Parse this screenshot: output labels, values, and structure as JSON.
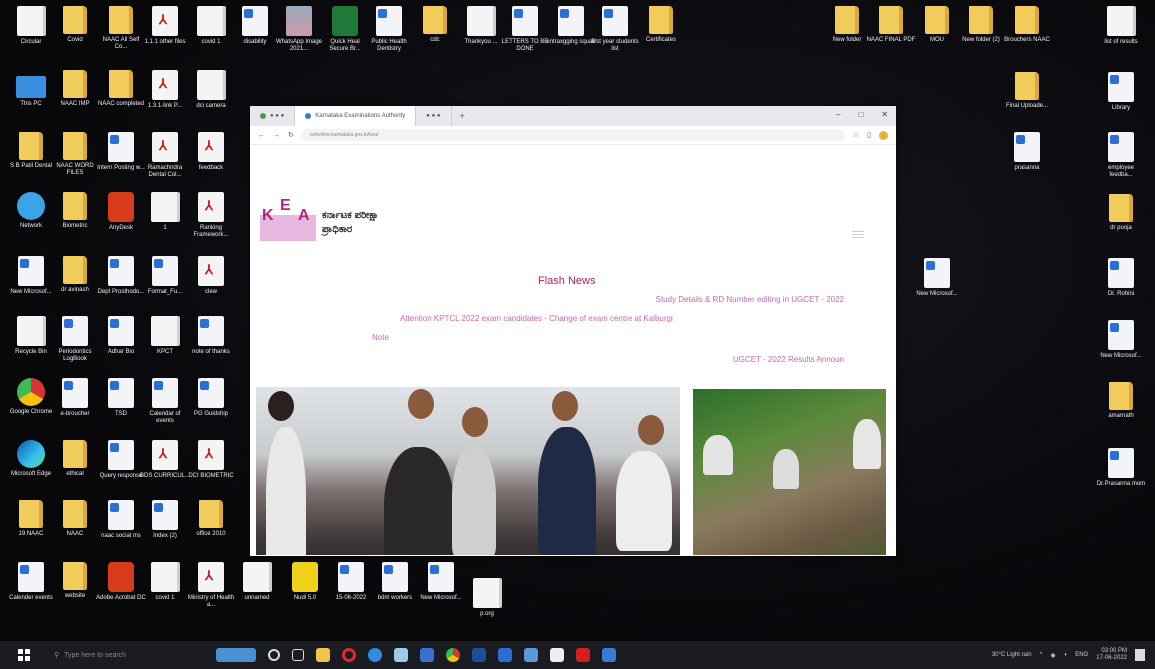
{
  "desktop_icons": [
    {
      "label": "Circular",
      "type": "file"
    },
    {
      "label": "Covid",
      "type": "folder"
    },
    {
      "label": "NAAC All Self Co...",
      "type": "folder"
    },
    {
      "label": "1.1.1 other files",
      "type": "pdf"
    },
    {
      "label": "covid 1",
      "type": "file"
    },
    {
      "label": "disability",
      "type": "word"
    },
    {
      "label": "WhatsApp Image 2021...",
      "type": "img"
    },
    {
      "label": "Quick Heal Secure Br...",
      "type": "green"
    },
    {
      "label": "Public Health Dentistry",
      "type": "word"
    },
    {
      "label": "cdc",
      "type": "folder"
    },
    {
      "label": "Thankyou ...",
      "type": "file"
    },
    {
      "label": "LETTERS TO BE DONE",
      "type": "word"
    },
    {
      "label": "entraxgging squad",
      "type": "word"
    },
    {
      "label": "first year students list",
      "type": "word"
    },
    {
      "label": "Certificates",
      "type": "folder"
    },
    {
      "label": "New folder",
      "type": "folder"
    },
    {
      "label": "NAAC FINAL PDF",
      "type": "folder"
    },
    {
      "label": "MOU",
      "type": "folder"
    },
    {
      "label": "New folder (2)",
      "type": "folder"
    },
    {
      "label": "Brouchers NAAC",
      "type": "folder"
    },
    {
      "label": "list of results",
      "type": "file"
    },
    {
      "label": "This PC",
      "type": "pc"
    },
    {
      "label": "NAAC IMP",
      "type": "folder"
    },
    {
      "label": "NAAC completed",
      "type": "folder"
    },
    {
      "label": "1.3.1-link P...",
      "type": "pdf"
    },
    {
      "label": "dci camera",
      "type": "file"
    },
    {
      "label": "Final Uploade...",
      "type": "folder"
    },
    {
      "label": "Library",
      "type": "word"
    },
    {
      "label": "S B Patil Dental",
      "type": "folder"
    },
    {
      "label": "NAAC WORD FILES",
      "type": "folder"
    },
    {
      "label": "Intern Posting w...",
      "type": "word"
    },
    {
      "label": "Ramachndra Dental Col...",
      "type": "pdf"
    },
    {
      "label": "feedback",
      "type": "pdf"
    },
    {
      "label": "prasanna",
      "type": "word"
    },
    {
      "label": "employee feedba...",
      "type": "word"
    },
    {
      "label": "Network",
      "type": "globe"
    },
    {
      "label": "Biometric",
      "type": "folder"
    },
    {
      "label": "AnyDesk",
      "type": "red"
    },
    {
      "label": "1",
      "type": "file"
    },
    {
      "label": "Ranking Framework...",
      "type": "pdf"
    },
    {
      "label": "dr pooja",
      "type": "folder"
    },
    {
      "label": "New Microsof...",
      "type": "word"
    },
    {
      "label": "dr avinash",
      "type": "folder"
    },
    {
      "label": "Dept Prosthodo...",
      "type": "word"
    },
    {
      "label": "Format_Fu...",
      "type": "word"
    },
    {
      "label": "clew",
      "type": "pdf"
    },
    {
      "label": "New Microsof...",
      "type": "word"
    },
    {
      "label": "Dr. Rohini",
      "type": "word"
    },
    {
      "label": "Recycle Bin",
      "type": "file"
    },
    {
      "label": "Periodontics LogBook",
      "type": "word"
    },
    {
      "label": "Adhar Bio",
      "type": "word"
    },
    {
      "label": "KPCT",
      "type": "file"
    },
    {
      "label": "note of thanks",
      "type": "word"
    },
    {
      "label": "New Microsof...",
      "type": "word"
    },
    {
      "label": "Google Chrome",
      "type": "chrome"
    },
    {
      "label": "e-broucher",
      "type": "word"
    },
    {
      "label": "TSD",
      "type": "word"
    },
    {
      "label": "Calendar of events",
      "type": "word"
    },
    {
      "label": "PG Guidship",
      "type": "word"
    },
    {
      "label": "amarnath",
      "type": "folder"
    },
    {
      "label": "Microsoft Edge",
      "type": "edge"
    },
    {
      "label": "ethical",
      "type": "folder"
    },
    {
      "label": "Query response",
      "type": "word"
    },
    {
      "label": "BDS CURRICUL...",
      "type": "pdf"
    },
    {
      "label": "DCI BIOMETRIC",
      "type": "pdf"
    },
    {
      "label": "Dr.Prasanna mom",
      "type": "word"
    },
    {
      "label": "19 NAAC",
      "type": "folder"
    },
    {
      "label": "NAAC",
      "type": "folder"
    },
    {
      "label": "naac social ms",
      "type": "word"
    },
    {
      "label": "Index (2)",
      "type": "word"
    },
    {
      "label": "office 2010",
      "type": "folder"
    },
    {
      "label": "Calender events",
      "type": "word"
    },
    {
      "label": "website",
      "type": "folder"
    },
    {
      "label": "Adobe Acrobat DC",
      "type": "red"
    },
    {
      "label": "covid 1",
      "type": "file"
    },
    {
      "label": "Ministry of Health a...",
      "type": "pdf"
    },
    {
      "label": "unnamed",
      "type": "file"
    },
    {
      "label": "Nudi 5.0",
      "type": "yellow"
    },
    {
      "label": "15-06-2022",
      "type": "word"
    },
    {
      "label": "bdm workers",
      "type": "word"
    },
    {
      "label": "New Microsof...",
      "type": "word"
    },
    {
      "label": "p.org",
      "type": "file"
    }
  ],
  "browser": {
    "tabs": [
      "● ● ●",
      "Karnataka Examinations Authority",
      "● ● ●"
    ],
    "url": "cetonline.karnataka.gov.in/kea/",
    "controls": {
      "minimize": "–",
      "maximize": "□",
      "close": "✕"
    },
    "new_tab": "+"
  },
  "kea": {
    "logo": {
      "k": "K",
      "e": "E",
      "a": "A"
    },
    "title_line1": "ಕರ್ನಾಟಕ ಪರೀಕ್ಷಾ",
    "title_line2": "ಪ್ರಾಧಿಕಾರ",
    "flash_heading": "Flash News",
    "flash_items": [
      "Study Details & RD Number editing in UGCET - 2022",
      "Attention KPTCL 2022 exam candidates - Change of exam centre at Kalburgi",
      "Note",
      "UGCET - 2022 Results Announ"
    ]
  },
  "taskbar": {
    "search_placeholder": "Type here to search",
    "weather": "30°C Light rain",
    "time": "03:00 PM",
    "date": "17-06-2022",
    "lang": "ENG"
  }
}
